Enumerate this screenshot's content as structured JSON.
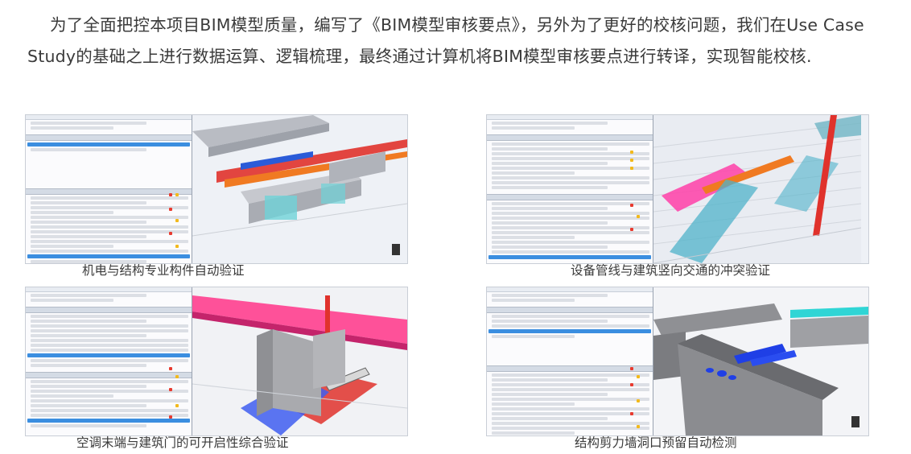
{
  "intro": {
    "text": "为了全面把控本项目BIM模型质量，编写了《BIM模型审核要点》，另外为了更好的校核问题，我们在Use Case Study的基础之上进行数据运算、逻辑梳理，最终通过计算机将BIM模型审核要点进行转译，实现智能校核."
  },
  "figures": [
    {
      "caption": "机电与结构专业构件自动验证"
    },
    {
      "caption": "设备管线与建筑竖向交通的冲突验证"
    },
    {
      "caption": "空调末端与建筑门的可开启性综合验证"
    },
    {
      "caption": "结构剪力墙洞口预留自动检测"
    }
  ],
  "colors": {
    "selection": "#3b8ee0",
    "pipe_red": "#e0322c",
    "pipe_orange": "#f07a22",
    "stair_cyan": "#4fb3c9",
    "duct_pink": "#ff3fa8",
    "wall_grey": "#8f9094",
    "opening_blue": "#1f3fe6"
  }
}
